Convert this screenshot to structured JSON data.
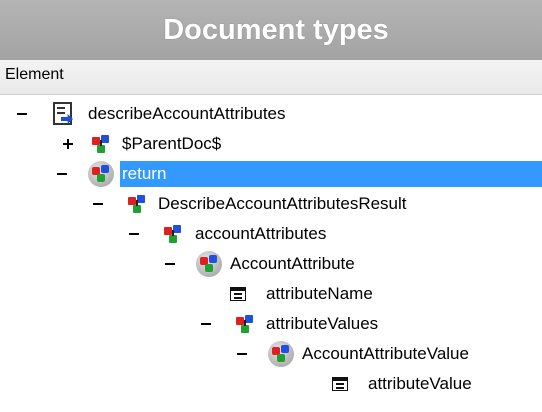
{
  "header": {
    "title": "Document types"
  },
  "columns": {
    "element": "Element"
  },
  "tree": [
    {
      "label": "describeAccountAttributes",
      "icon": "document-icon",
      "expander": "minus"
    },
    {
      "label": "$ParentDoc$",
      "icon": "element-cluster-icon",
      "expander": "plus"
    },
    {
      "label": "return",
      "icon": "circled-element-icon",
      "expander": "minus",
      "selected": true
    },
    {
      "label": "DescribeAccountAttributesResult",
      "icon": "element-cluster-icon",
      "expander": "minus"
    },
    {
      "label": "accountAttributes",
      "icon": "element-cluster-icon",
      "expander": "minus"
    },
    {
      "label": "AccountAttribute",
      "icon": "circled-element-icon",
      "expander": "minus"
    },
    {
      "label": "attributeName",
      "icon": "attribute-icon",
      "expander": "none"
    },
    {
      "label": "attributeValues",
      "icon": "element-cluster-icon",
      "expander": "minus"
    },
    {
      "label": "AccountAttributeValue",
      "icon": "circled-element-icon",
      "expander": "minus"
    },
    {
      "label": "attributeValue",
      "icon": "attribute-icon",
      "expander": "none"
    }
  ],
  "colors": {
    "selection": "#3399ff",
    "title_bg": "#a9a9a9"
  }
}
